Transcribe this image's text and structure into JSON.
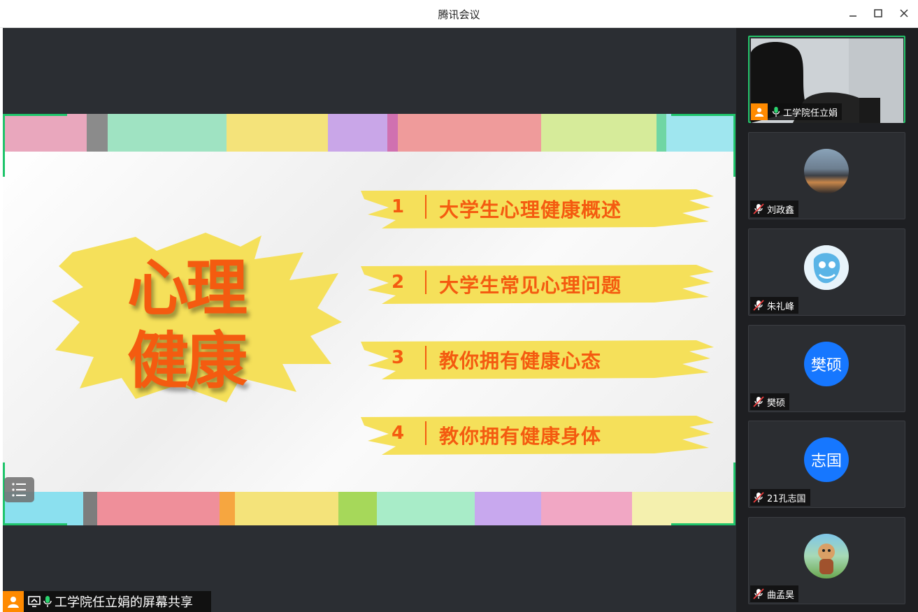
{
  "window": {
    "title": "腾讯会议",
    "minimize_label": "–",
    "maximize_label": "□",
    "close_label": "✕"
  },
  "slide": {
    "title_line1": "心理",
    "title_line2": "健康",
    "items": [
      {
        "num": "1",
        "text": "大学生心理健康概述"
      },
      {
        "num": "2",
        "text": "大学生常见心理问题"
      },
      {
        "num": "3",
        "text": "教你拥有健康心态"
      },
      {
        "num": "4",
        "text": "教你拥有健康身体"
      }
    ],
    "accent_color": "#f45b10",
    "brush_color": "#f5e05a"
  },
  "share": {
    "label": "工学院任立娟的屏幕共享"
  },
  "participants": [
    {
      "name": "工学院任立娟",
      "avatar": "video",
      "mic": "on"
    },
    {
      "name": "刘政鑫",
      "avatar": "city-photo",
      "mic": "muted"
    },
    {
      "name": "朱礼峰",
      "avatar": "mask-photo",
      "mic": "muted"
    },
    {
      "name": "樊硕",
      "avatar_text": "樊硕",
      "avatar": "text",
      "mic": "muted"
    },
    {
      "name": "21孔志国",
      "avatar_text": "志国",
      "avatar": "text",
      "mic": "muted"
    },
    {
      "name": "曲孟昊",
      "avatar": "cartoon-photo",
      "mic": "muted"
    }
  ]
}
